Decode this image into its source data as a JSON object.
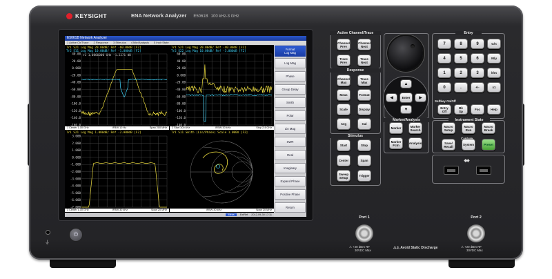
{
  "brand": {
    "name": "KEYSIGHT",
    "model": "ENA Network Analyzer",
    "code": "E5061B",
    "range": "100 kHz-3 GHz"
  },
  "screen": {
    "title": "E5061B Network Analyzer",
    "menu": [
      "1 Active Ch/Trace",
      "2 Response",
      "3 Stimulus",
      "4 Mkr/Analysis",
      "5 Instr State"
    ],
    "channels": [
      {
        "trace": "Tr1 S21 Log Mag 20.00dB/ Ref -60.00dB [F2]",
        "trace2": "Tr2 S11 Log Mag 10.00dB/ Ref -1.000dB [F2]",
        "marker": ">1  1.0860000 GHz  -1.2271 dB",
        "yticks": [
          "40.00",
          "20.00",
          "0.000",
          "-20.00",
          "-40.00",
          "-60.00",
          "-80.00",
          "-100.0",
          "-120.0",
          "-140.0",
          "-160.0"
        ],
        "footer": [
          "1  Center 1.00 GHz",
          "IFBW 10 Hz",
          "Span 200 MHz"
        ]
      },
      {
        "trace": "Tr1 S21 Log Mag 20.00dB/ Ref -40.00dB [F2]",
        "trace2": "Tr2 S22 Log Mag 10.00dB/ Ref -3.000dB [F2]",
        "yticks": [
          "60.00",
          "40.00",
          "20.00",
          "0.000",
          "-20.00",
          "-40.00",
          "-60.00",
          "-80.00",
          "-100.0",
          "-120.0",
          "-140.0"
        ],
        "footer": [
          "2  Start 300 kHz",
          "IFBW 30 kHz",
          "Stop 2.4 GHz"
        ]
      },
      {
        "trace": "Tr1 S21 Log Mag 1.000dB/ Ref -2.000dB [F2]",
        "yticks": [
          "3.000",
          "2.000",
          "1.000",
          "0.000",
          "-1.000",
          "-2.000",
          "-3.000",
          "-4.000",
          "-5.000",
          "-6.000",
          "-7.000"
        ],
        "footer": [
          "3  Center 1.00 GHz",
          "IFBW 30 kHz",
          "Span 20 MHz"
        ]
      },
      {
        "trace": "Tr1 S11 Smith (Lin/Phase) Scale 1.000U [F2]",
        "footer": [
          "",
          "IFBW 30 kHz",
          "Span 20 MHz"
        ]
      }
    ],
    "softkeys": {
      "header": "Format",
      "header_sub": "Log Mag",
      "items": [
        "Log Mag",
        "Phase",
        "Group Delay",
        "Smith",
        "Polar",
        "Lin Mag",
        "SWR",
        "Real",
        "Imaginary",
        "Expand Phase",
        "Positive Phase",
        "Return"
      ]
    },
    "status": {
      "mode": "Meas",
      "ext": "ExtRef",
      "datetime": "2012-09-30 17:11"
    }
  },
  "panels": {
    "active": {
      "title": "Active Channel/Trace",
      "buttons": [
        [
          "Channel",
          "Prev"
        ],
        [
          "Channel",
          "Next"
        ],
        [
          "Trace",
          "Prev"
        ],
        [
          "Trace",
          "Next"
        ]
      ]
    },
    "response": {
      "title": "Response",
      "buttons": [
        [
          "Channel",
          "Max"
        ],
        [
          "Trace",
          "Max"
        ],
        [
          "Meas",
          ""
        ],
        [
          "Format",
          ""
        ],
        [
          "Scale",
          ""
        ],
        [
          "Display",
          ""
        ],
        [
          "Avg",
          ""
        ],
        [
          "Cal",
          ""
        ]
      ]
    },
    "stimulus": {
      "title": "Stimulus",
      "buttons": [
        [
          "Start",
          ""
        ],
        [
          "Stop",
          ""
        ],
        [
          "Center",
          ""
        ],
        [
          "Span",
          ""
        ],
        [
          "Sweep",
          "Setup"
        ],
        [
          "Trigger",
          ""
        ]
      ]
    },
    "marker": {
      "title": "Marker/Analysis",
      "buttons": [
        [
          "Marker",
          ""
        ],
        [
          "Marker",
          "Search"
        ],
        [
          "Marker",
          "Fctn"
        ],
        [
          "Analysis",
          ""
        ]
      ]
    },
    "entry": {
      "title": "Entry",
      "keys": [
        "7",
        "8",
        "9",
        "G/n",
        "4",
        "5",
        "6",
        "M/μ",
        "1",
        "2",
        "3",
        "k/m",
        "0",
        ".",
        "+/-",
        "x1"
      ],
      "softkey_label": "Softkey On/Off",
      "fn": [
        [
          "Entry",
          "Off"
        ],
        [
          "Bk",
          "Sp"
        ],
        [
          "Foc",
          ""
        ],
        [
          "Help",
          ""
        ]
      ]
    },
    "instr": {
      "title": "Instrument State",
      "buttons": [
        [
          "Macro",
          "Setup"
        ],
        [
          "Macro",
          "Run"
        ],
        [
          "Macro",
          "Break"
        ]
      ],
      "capture": "Capture",
      "buttons2": [
        [
          "Save/",
          "Recall"
        ],
        [
          "System",
          ""
        ],
        [
          "Preset",
          ""
        ]
      ]
    },
    "nav": {
      "enter": "Enter"
    }
  },
  "ports": {
    "p1": "Port 1",
    "p2": "Port 2",
    "rating": [
      "+20 dBm RF",
      "30VDC Max"
    ],
    "static": "Avoid Static Discharge"
  }
}
